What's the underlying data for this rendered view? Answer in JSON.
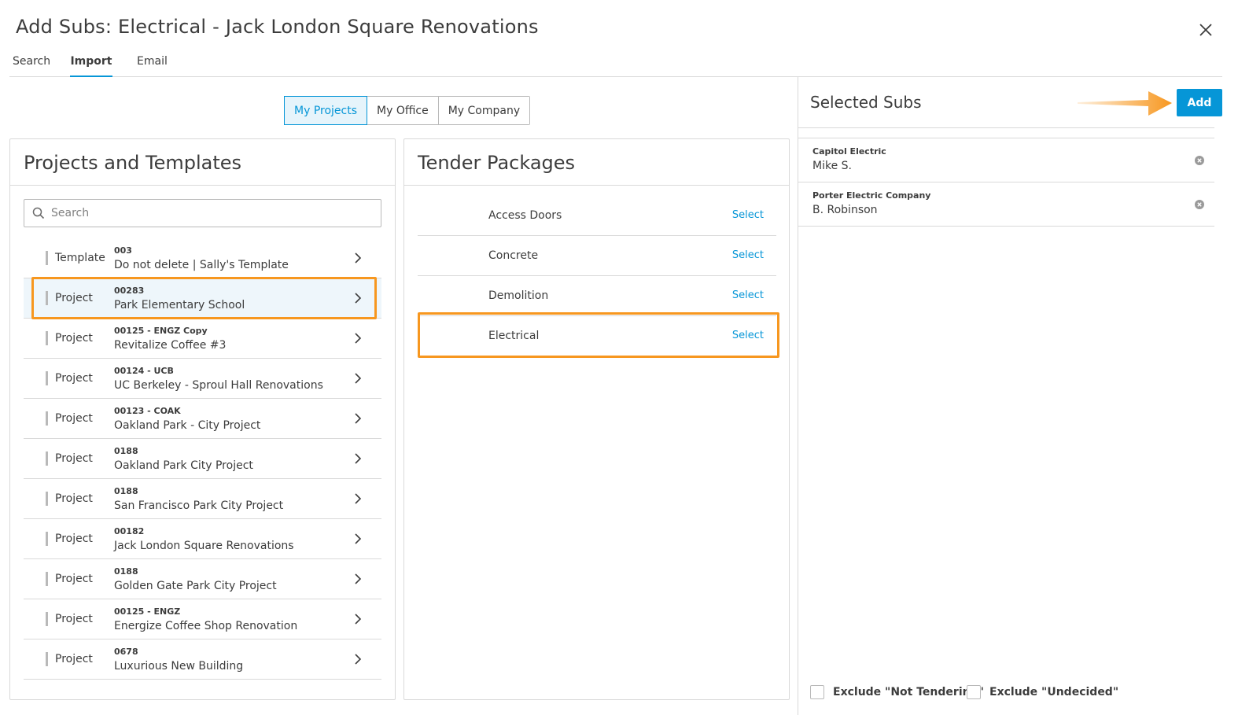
{
  "dialog": {
    "title": "Add Subs: Electrical - Jack London Square Renovations"
  },
  "tabs": [
    {
      "label": "Search",
      "active": false
    },
    {
      "label": "Import",
      "active": true
    },
    {
      "label": "Email",
      "active": false
    }
  ],
  "scope": {
    "options": [
      "My Projects",
      "My Office",
      "My Company"
    ],
    "selected": "My Projects"
  },
  "projects_panel": {
    "title": "Projects and Templates",
    "search_placeholder": "Search",
    "items": [
      {
        "kind": "Template",
        "code": "003",
        "name": "Do not delete | Sally's Template"
      },
      {
        "kind": "Project",
        "code": "00283",
        "name": "Park Elementary School",
        "highlighted": true
      },
      {
        "kind": "Project",
        "code": "00125 - ENGZ Copy",
        "name": "Revitalize Coffee #3"
      },
      {
        "kind": "Project",
        "code": "00124 - UCB",
        "name": "UC Berkeley - Sproul Hall Renovations"
      },
      {
        "kind": "Project",
        "code": "00123 - COAK",
        "name": "Oakland Park - City Project"
      },
      {
        "kind": "Project",
        "code": "0188",
        "name": "Oakland Park City Project"
      },
      {
        "kind": "Project",
        "code": "0188",
        "name": "San Francisco Park City Project"
      },
      {
        "kind": "Project",
        "code": "00182",
        "name": "Jack London Square Renovations"
      },
      {
        "kind": "Project",
        "code": "0188",
        "name": "Golden Gate Park City Project"
      },
      {
        "kind": "Project",
        "code": "00125 - ENGZ",
        "name": "Energize Coffee Shop Renovation"
      },
      {
        "kind": "Project",
        "code": "0678",
        "name": "Luxurious New Building"
      }
    ]
  },
  "packages_panel": {
    "title": "Tender Packages",
    "select_label": "Select",
    "items": [
      {
        "name": "Access Doors"
      },
      {
        "name": "Concrete"
      },
      {
        "name": "Demolition"
      },
      {
        "name": "Electrical",
        "highlighted": true
      }
    ]
  },
  "selected_subs": {
    "title": "Selected Subs",
    "add_label": "Add",
    "items": [
      {
        "company": "Capitol Electric",
        "contact": "Mike S."
      },
      {
        "company": "Porter Electric Company",
        "contact": "B. Robinson"
      }
    ]
  },
  "filters": {
    "exclude_not_tendering": "Exclude \"Not Tendering\"",
    "exclude_undecided": "Exclude \"Undecided\""
  },
  "colors": {
    "accent": "#0696d7",
    "highlight_border": "#f7971f",
    "text": "#3c3c3c",
    "border": "#d9d9d9"
  },
  "icons": {
    "close": "close-icon",
    "search": "search-icon",
    "chevron": "chevron-right-icon",
    "remove": "remove-circle-icon",
    "arrow": "orange-arrow-annotation"
  }
}
